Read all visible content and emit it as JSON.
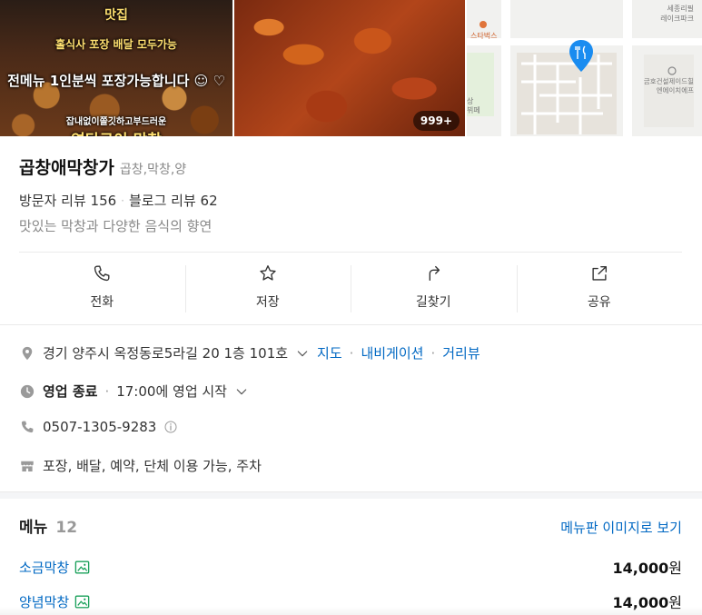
{
  "photos": {
    "caption_top": "맛집",
    "caption_1": "홀식사 포장 배달 모두가능",
    "caption_2": "전메뉴 1인분씩 포장가능합니다 ☺ ♡",
    "caption_3": "잡내없이쫄깃하고부드러운",
    "caption_4": "연탄구이 막창",
    "count": "999+",
    "map_label_1": "세종리필",
    "map_label_2": "레이크파크",
    "map_label_3": "스타벅스",
    "map_label_4": "금호건설제이드힐",
    "map_label_5": "엔에이치에프",
    "map_label_6": "상",
    "map_label_7": "뷔페"
  },
  "place": {
    "name": "곱창애막창가",
    "category": "곱창,막창,양",
    "visitor_reviews": "방문자 리뷰 156",
    "blog_reviews": "블로그 리뷰 62",
    "separator": "·",
    "description": "맛있는 막창과 다양한 음식의 향연"
  },
  "actions": {
    "call": "전화",
    "save": "저장",
    "directions": "길찾기",
    "share": "공유"
  },
  "info": {
    "address": "경기 양주시 옥정동로5라길 20 1층 101호",
    "map_link": "지도",
    "navigation_link": "내비게이션",
    "streetview_link": "거리뷰",
    "separator": "·",
    "hours_status": "영업 종료",
    "hours_next": "17:00에 영업 시작",
    "phone": "0507-1305-9283",
    "conveniences": "포장, 배달, 예약, 단체 이용 가능, 주차"
  },
  "menu": {
    "title": "메뉴",
    "count": "12",
    "image_link": "메뉴판 이미지로 보기",
    "items": [
      {
        "name": "소금막창",
        "price": "14,000",
        "unit": "원"
      },
      {
        "name": "양념막창",
        "price": "14,000",
        "unit": "원"
      }
    ]
  },
  "colors": {
    "link": "#0068c3",
    "map_pin": "#1a8cf0",
    "image_icon": "#1aa05a"
  }
}
